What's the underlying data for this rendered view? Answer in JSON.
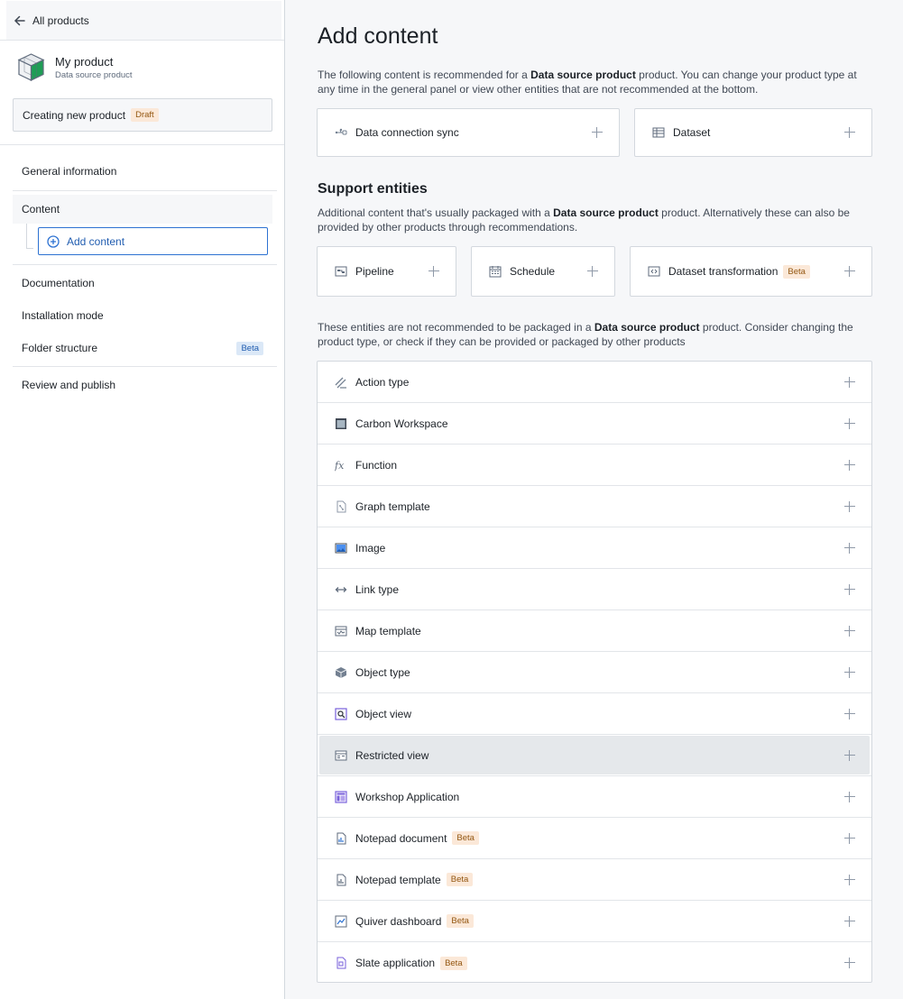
{
  "sidebar": {
    "back_label": "All products",
    "product_name": "My product",
    "product_type": "Data source product",
    "status_label": "Creating new product",
    "status_tag": "Draft",
    "nav": {
      "general": "General information",
      "content": "Content",
      "add_content": "Add content",
      "documentation": "Documentation",
      "installation": "Installation mode",
      "folder": "Folder structure",
      "folder_tag": "Beta",
      "review": "Review and publish"
    }
  },
  "main": {
    "title": "Add content",
    "intro": {
      "pre": "The following content is recommended for a ",
      "bold": "Data source product",
      "post": " product. You can change your product type at any time in the general panel or view other entities that are not recommended at the bottom."
    },
    "recommended": [
      {
        "label": "Data connection sync",
        "icon": "data-connection-sync-icon"
      },
      {
        "label": "Dataset",
        "icon": "dataset-icon"
      }
    ],
    "support_title": "Support entities",
    "support_desc": {
      "pre": "Additional content that's usually packaged with a ",
      "bold": "Data source product",
      "post": " product. Alternatively these can also be provided by other products through recommendations."
    },
    "support": [
      {
        "label": "Pipeline",
        "icon": "pipeline-icon"
      },
      {
        "label": "Schedule",
        "icon": "schedule-icon"
      },
      {
        "label": "Dataset transformation",
        "tag": "Beta",
        "icon": "dataset-transformation-icon"
      }
    ],
    "not_rec_desc": {
      "pre": "These entities are not recommended to be packaged in a ",
      "bold": "Data source product",
      "post": " product. Consider changing the product type, or check if they can be provided or packaged by other products"
    },
    "not_recommended": [
      {
        "label": "Action type",
        "icon": "action-type-icon"
      },
      {
        "label": "Carbon Workspace",
        "icon": "carbon-workspace-icon"
      },
      {
        "label": "Function",
        "icon": "function-icon"
      },
      {
        "label": "Graph template",
        "icon": "graph-template-icon"
      },
      {
        "label": "Image",
        "icon": "image-icon"
      },
      {
        "label": "Link type",
        "icon": "link-type-icon"
      },
      {
        "label": "Map template",
        "icon": "map-template-icon"
      },
      {
        "label": "Object type",
        "icon": "object-type-icon"
      },
      {
        "label": "Object view",
        "icon": "object-view-icon"
      },
      {
        "label": "Restricted view",
        "icon": "restricted-view-icon"
      },
      {
        "label": "Workshop Application",
        "icon": "workshop-application-icon"
      },
      {
        "label": "Notepad document",
        "tag": "Beta",
        "icon": "notepad-document-icon"
      },
      {
        "label": "Notepad template",
        "tag": "Beta",
        "icon": "notepad-template-icon"
      },
      {
        "label": "Quiver dashboard",
        "tag": "Beta",
        "icon": "quiver-dashboard-icon"
      },
      {
        "label": "Slate application",
        "tag": "Beta",
        "icon": "slate-application-icon"
      }
    ]
  }
}
